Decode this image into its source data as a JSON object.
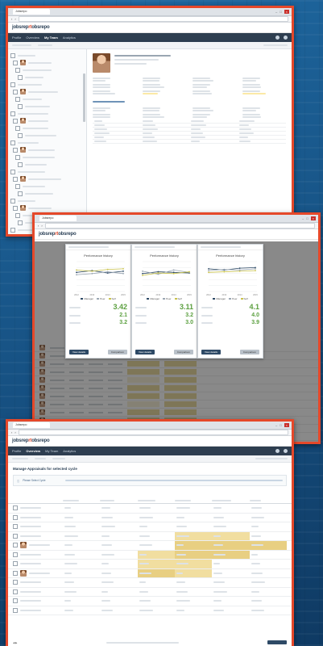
{
  "theme": {
    "accent": "#e5482a",
    "nav_bg": "#2e3e50",
    "highlight": "#f1dea0",
    "score_green": "#5ca040"
  },
  "logo": {
    "text": "jobsrepo",
    "accent": "rt"
  },
  "screens": {
    "s1": {
      "tab": "Jobsrepo",
      "nav": [
        "Profile",
        "Overview",
        "My Team",
        "Analytics"
      ]
    },
    "s2": {
      "tab": "Jobsrepo",
      "chart_title": "Performance history",
      "legend": [
        "Manager",
        "Peer",
        "Self"
      ],
      "scores": [
        [
          "3.42",
          "2.1",
          "3.2"
        ],
        [
          "3.11",
          "3.2",
          "3.0"
        ],
        [
          "4.1",
          "4.0",
          "3.9"
        ]
      ],
      "btn_primary": "View details",
      "btn_secondary": "Comparison"
    },
    "s3": {
      "tab": "Jobsrepo",
      "title": "Manage Appraisals for selected cycle",
      "notice": "Please Select Cycle",
      "nav": [
        "Profile",
        "Overview",
        "My Team",
        "Analytics"
      ]
    }
  },
  "chart_data": [
    {
      "type": "line",
      "title": "Performance history",
      "x": [
        "2012",
        "2013",
        "2014",
        "2015"
      ],
      "series": [
        {
          "name": "Manager",
          "values": [
            3.2,
            3.5,
            3.1,
            3.4
          ]
        },
        {
          "name": "Peer",
          "values": [
            2.8,
            3.0,
            3.3,
            3.0
          ]
        },
        {
          "name": "Self",
          "values": [
            3.6,
            3.4,
            3.7,
            3.8
          ]
        }
      ],
      "ylim": [
        0,
        5
      ]
    },
    {
      "type": "line",
      "title": "Performance history",
      "x": [
        "2012",
        "2013",
        "2014",
        "2015"
      ],
      "series": [
        {
          "name": "Manager",
          "values": [
            3.0,
            3.3,
            3.2,
            3.1
          ]
        },
        {
          "name": "Peer",
          "values": [
            3.4,
            2.9,
            3.6,
            3.2
          ]
        },
        {
          "name": "Self",
          "values": [
            2.7,
            3.1,
            3.0,
            3.3
          ]
        }
      ],
      "ylim": [
        0,
        5
      ]
    },
    {
      "type": "line",
      "title": "Performance history",
      "x": [
        "2012",
        "2013",
        "2014",
        "2015"
      ],
      "series": [
        {
          "name": "Manager",
          "values": [
            3.8,
            3.6,
            3.9,
            4.0
          ]
        },
        {
          "name": "Peer",
          "values": [
            3.5,
            3.7,
            3.6,
            3.8
          ]
        },
        {
          "name": "Self",
          "values": [
            3.2,
            3.3,
            3.4,
            3.5
          ]
        }
      ],
      "ylim": [
        0,
        5
      ]
    }
  ]
}
